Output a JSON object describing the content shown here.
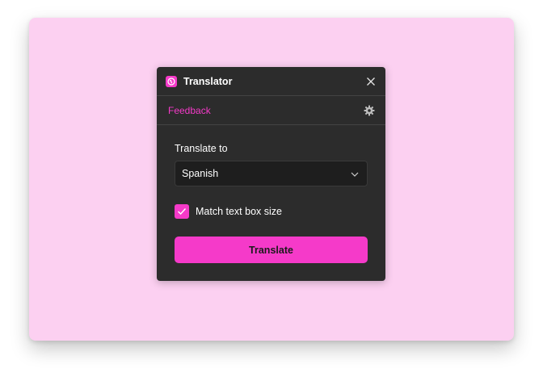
{
  "window": {
    "title": "Translator",
    "app_icon": "globe-icon",
    "close_icon": "close-icon"
  },
  "toolbar": {
    "feedback_label": "Feedback",
    "settings_icon": "gear-icon"
  },
  "form": {
    "translate_to_label": "Translate to",
    "language_selected": "Spanish",
    "match_size_label": "Match text box size",
    "match_size_checked": true,
    "translate_button_label": "Translate"
  },
  "colors": {
    "accent": "#f53ac9",
    "panel_bg": "#2c2c2c",
    "canvas_bg": "#fcd0f1",
    "select_bg": "#1e1e1e"
  }
}
